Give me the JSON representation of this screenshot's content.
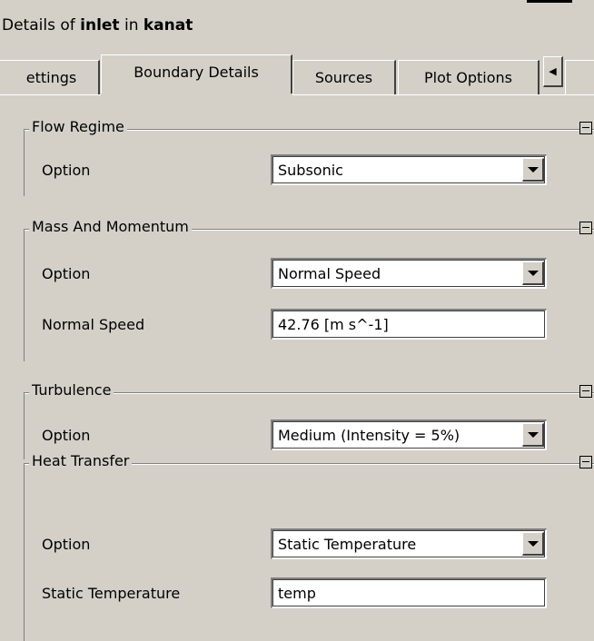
{
  "window": {
    "title_prefix": "Details of ",
    "title_object": "inlet",
    "title_mid": " in ",
    "title_domain": "kanat"
  },
  "tabs": [
    {
      "label": "ettings",
      "active": false
    },
    {
      "label": "Boundary Details",
      "active": true
    },
    {
      "label": "Sources",
      "active": false
    },
    {
      "label": "Plot Options",
      "active": false
    }
  ],
  "tab_scroll": {
    "left_icon": "scroll-left-icon"
  },
  "sections": {
    "flow_regime": {
      "title": "Flow Regime",
      "option_label": "Option",
      "option_value": "Subsonic"
    },
    "mass_momentum": {
      "title": "Mass And Momentum",
      "option_label": "Option",
      "option_value": "Normal Speed",
      "speed_label": "Normal Speed",
      "speed_value": "42.76 [m s^-1]"
    },
    "turbulence": {
      "title": "Turbulence",
      "option_label": "Option",
      "option_value": "Medium (Intensity = 5%)"
    },
    "heat_transfer": {
      "title": "Heat Transfer",
      "option_label": "Option",
      "option_value": "Static Temperature",
      "temp_label": "Static Temperature",
      "temp_value": "temp"
    }
  }
}
